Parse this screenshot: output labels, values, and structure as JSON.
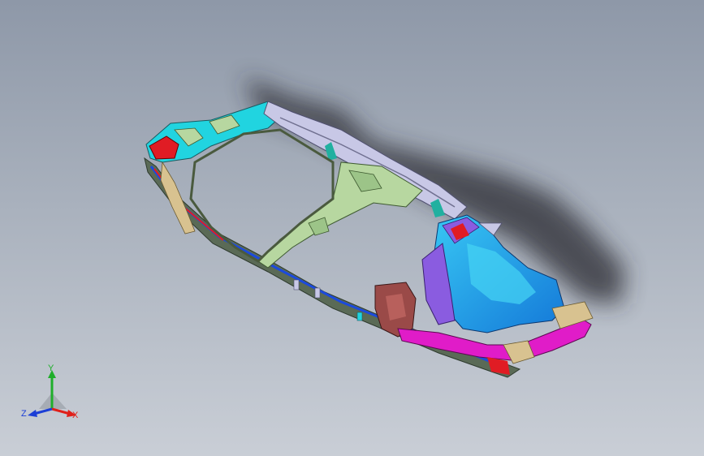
{
  "viewport": {
    "model_name": "",
    "background_top": "#8e98a8",
    "background_bottom": "#c9ced6"
  },
  "triad": {
    "x_label": "X",
    "y_label": "Y",
    "z_label": "Z",
    "x_color": "#e0201a",
    "y_color": "#1fae2b",
    "z_color": "#1c3fd6"
  },
  "model": {
    "part_colors": [
      "#21d4e0",
      "#e01c24",
      "#b7d7a0",
      "#c8c8e6",
      "#1ea0e6",
      "#8a5ce0",
      "#e01cc8",
      "#9a4a48",
      "#d8c290",
      "#1c4adc"
    ]
  }
}
